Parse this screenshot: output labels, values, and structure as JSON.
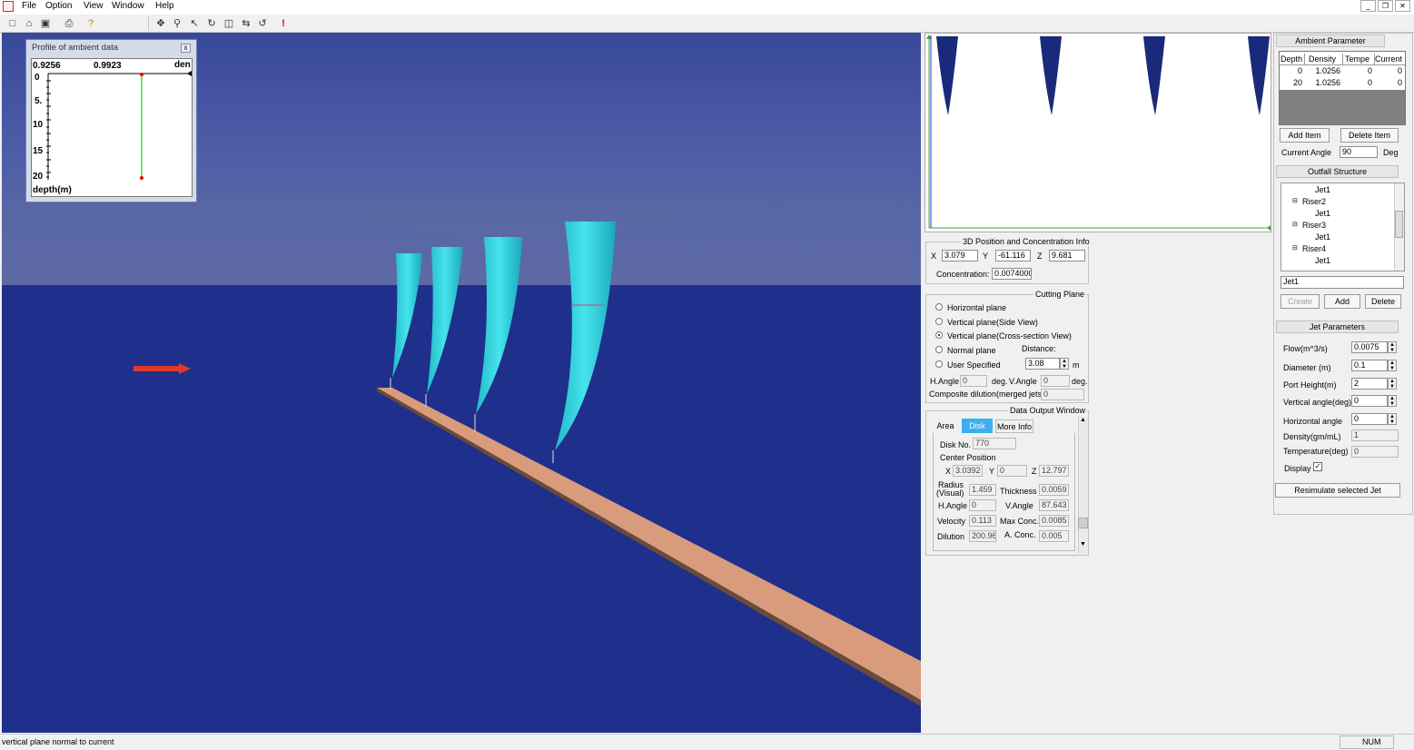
{
  "menu": {
    "file": "File",
    "option": "Option",
    "view": "View",
    "window": "Window",
    "help": "Help"
  },
  "toolbar": {
    "icons": [
      "new-icon",
      "open-icon",
      "save-icon",
      "print-icon",
      "help-icon",
      "pan-icon",
      "zoom-icon",
      "select-icon",
      "rotate-icon",
      "view-icon",
      "move-icon",
      "reset-icon",
      "stop-icon"
    ]
  },
  "profile": {
    "title": "Profile of ambient data",
    "x_min": "0.9256",
    "x_max": "0.9923",
    "x_label": "den",
    "y_ticks": [
      "0",
      "5.",
      "10",
      "15",
      "20"
    ],
    "y_label": "depth(m)"
  },
  "ambient": {
    "header": "Ambient Parameter",
    "columns": [
      "Depth",
      "Density",
      "Tempe",
      "Current"
    ],
    "rows": [
      [
        "0",
        "1.0256",
        "0",
        "0"
      ],
      [
        "20",
        "1.0256",
        "0",
        "0"
      ]
    ],
    "add_item": "Add Item",
    "delete_item": "Delete Item",
    "current_angle_label": "Current Angle",
    "current_angle_value": "90",
    "current_angle_unit": "Deg"
  },
  "outfall": {
    "header": "Outfall Structure",
    "tree": [
      "Jet1",
      "Riser2",
      "Jet1",
      "Riser3",
      "Jet1",
      "Riser4",
      "Jet1"
    ],
    "name_value": "Jet1",
    "create": "Create",
    "add": "Add",
    "delete": "Delete"
  },
  "jet": {
    "header": "Jet Parameters",
    "flow_label": "Flow(m^3/s)",
    "flow": "0.0075",
    "diameter_label": "Diameter (m)",
    "diameter": "0.1",
    "port_label": "Port Height(m)",
    "port": "2",
    "vangle_label": "Vertical angle(deg)",
    "vangle": "0",
    "hangle_label": "Horizontal angle",
    "hangle": "0",
    "density_label": "Density(gm/mL)",
    "density": "1",
    "temp_label": "Temperature(deg)",
    "temp": "0",
    "display_label": "Display",
    "resimulate": "Resimulate selected Jet"
  },
  "position": {
    "title": "3D Position and Concentration Info",
    "x_label": "X",
    "x": "3.079",
    "y_label": "Y",
    "y": "-61.116",
    "z_label": "Z",
    "z": "9.681",
    "conc_label": "Concentration:",
    "conc": "0.0074000"
  },
  "cutting": {
    "title": "Cutting Plane",
    "options": [
      "Horizontal plane",
      "Vertical plane(Side View)",
      "Vertical plane(Cross-section View)",
      "Normal plane",
      "User Specified"
    ],
    "selected": 2,
    "distance_label": "Distance:",
    "distance": "3.08",
    "distance_unit": "m",
    "hangle_label": "H.Angle",
    "hangle": "0",
    "hangle_unit": "deg.",
    "vangle_label": "V.Angle",
    "vangle": "0",
    "vangle_unit": "deg.",
    "composite_label": "Composite dilution(merged jets):",
    "composite": "0"
  },
  "output": {
    "title": "Data Output Window",
    "tabs": [
      "Area",
      "Disk",
      "More Info"
    ],
    "active_tab": 1,
    "disk_label": "Disk No.",
    "disk": "770",
    "center_label": "Center  Position",
    "cx_label": "X",
    "cx": "3.0392",
    "cy_label": "Y",
    "cy": "0",
    "cz_label": "Z",
    "cz": "12.797",
    "radius_label": "Radius",
    "radius_sub": "(Visual)",
    "radius": "1.459",
    "thick_label": "Thickness",
    "thick": "0.0059",
    "hangle_label": "H.Angle",
    "hangle": "0",
    "vangle_label": "V.Angle",
    "vangle": "87.643",
    "vel_label": "Velocity",
    "vel": "0.113",
    "maxc_label": "Max Conc.",
    "maxc": "0.0085",
    "dil_label": "Dilution",
    "dil": "200.96",
    "aconc_label": "A. Conc.",
    "aconc": "0.005"
  },
  "status": {
    "text": "vertical plane normal to current",
    "num": "NUM"
  },
  "colors": {
    "sea": "#1f2f8c",
    "plume": "#33d6e0",
    "pipe": "#d89c7c",
    "sky": "#4a5a9e",
    "topview_plume": "#1a2a7a"
  }
}
